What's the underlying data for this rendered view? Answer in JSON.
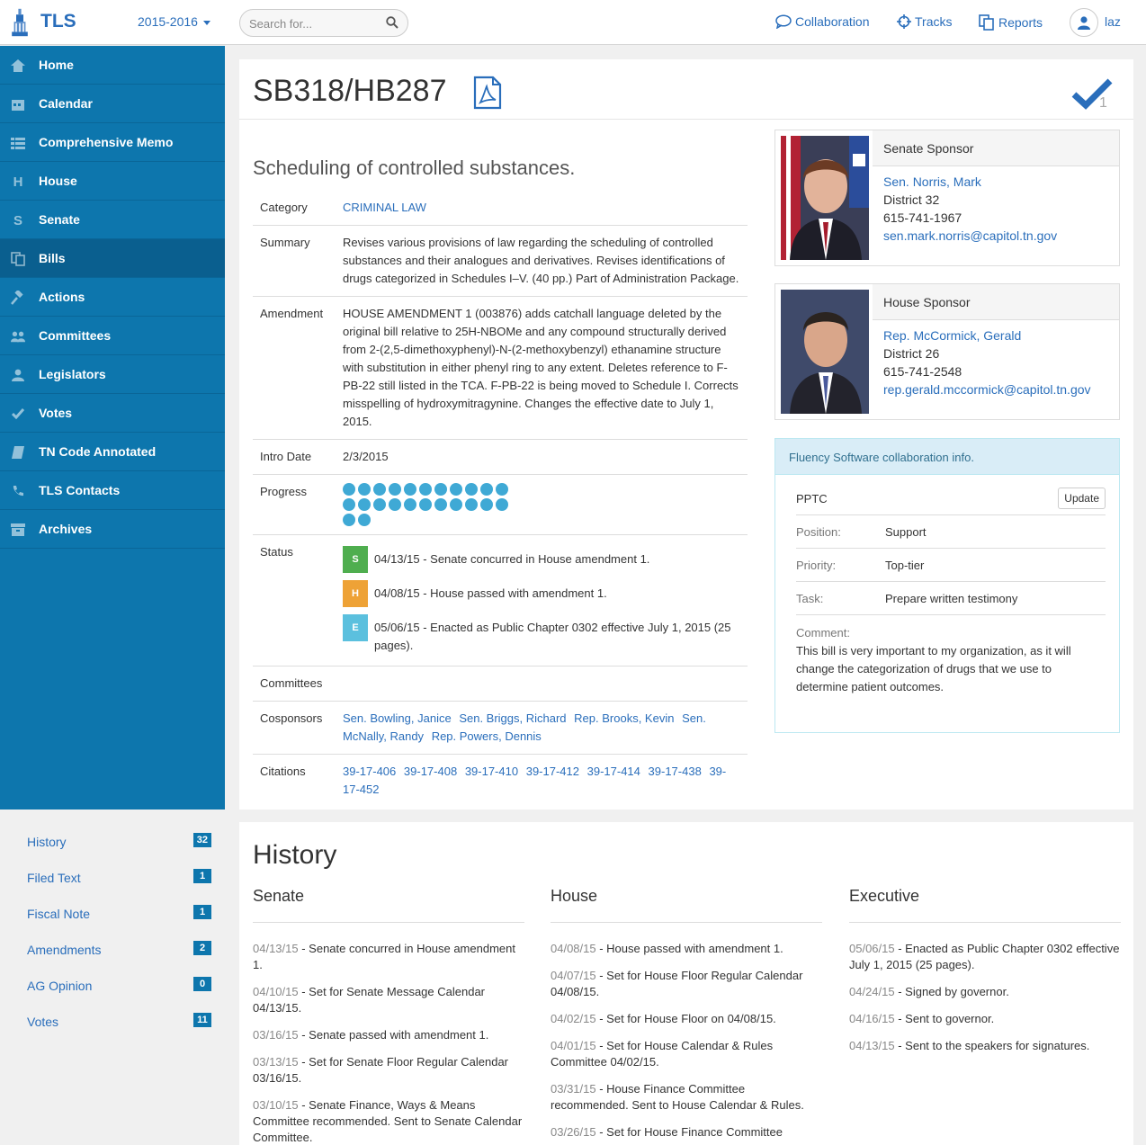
{
  "nav": {
    "logo_text": "TLS",
    "session": "2015-2016",
    "search_placeholder": "Search for...",
    "links": {
      "collaboration": "Collaboration",
      "tracks": "Tracks",
      "reports": "Reports"
    },
    "user": "laz"
  },
  "sidebar": {
    "items": [
      {
        "label": "Home",
        "icon": "home-icon"
      },
      {
        "label": "Calendar",
        "icon": "calendar-icon"
      },
      {
        "label": "Comprehensive Memo",
        "icon": "list-icon"
      },
      {
        "label": "House",
        "icon": "letter-h-icon"
      },
      {
        "label": "Senate",
        "icon": "letter-s-icon"
      },
      {
        "label": "Bills",
        "icon": "copy-icon"
      },
      {
        "label": "Actions",
        "icon": "gavel-icon"
      },
      {
        "label": "Committees",
        "icon": "users-icon"
      },
      {
        "label": "Legislators",
        "icon": "user-icon"
      },
      {
        "label": "Votes",
        "icon": "check-icon"
      },
      {
        "label": "TN Code Annotated",
        "icon": "book-icon"
      },
      {
        "label": "TLS Contacts",
        "icon": "phone-icon"
      },
      {
        "label": "Archives",
        "icon": "archive-icon"
      }
    ]
  },
  "subnav": [
    {
      "label": "History",
      "count": "32"
    },
    {
      "label": "Filed Text",
      "count": "1"
    },
    {
      "label": "Fiscal Note",
      "count": "1"
    },
    {
      "label": "Amendments",
      "count": "2"
    },
    {
      "label": "AG Opinion",
      "count": "0"
    },
    {
      "label": "Votes",
      "count": "11"
    }
  ],
  "bill": {
    "title": "SB318/HB287",
    "check_count": "1",
    "subtitle": "Scheduling of controlled substances.",
    "labels": {
      "category": "Category",
      "summary": "Summary",
      "amendment": "Amendment",
      "intro_date": "Intro Date",
      "progress": "Progress",
      "status": "Status",
      "committees": "Committees",
      "cosponsors": "Cosponsors",
      "citations": "Citations"
    },
    "category": "CRIMINAL LAW",
    "summary": "Revises various provisions of law regarding the scheduling of controlled substances and their analogues and derivatives. Revises identifications of drugs categorized in Schedules I–V. (40 pp.) Part of Administration Package.",
    "amendment": "HOUSE AMENDMENT 1 (003876) adds catchall language deleted by the original bill relative to 25H-NBOMe and any compound structurally derived from 2-(2,5-dimethoxyphenyl)-N-(2-methoxybenzyl) ethanamine structure with substitution in either phenyl ring to any extent. Deletes reference to F-PB-22 still listed in the TCA. F-PB-22 is being moved to Schedule I. Corrects misspelling of hydroxymitragynine. Changes the effective date to July 1, 2015.",
    "intro_date": "2/3/2015",
    "progress_steps": 24,
    "status": [
      {
        "badge": "S",
        "text": "04/13/15 - Senate concurred in House amendment 1."
      },
      {
        "badge": "H",
        "text": "04/08/15 - House passed with amendment 1."
      },
      {
        "badge": "E",
        "text": "05/06/15 - Enacted as Public Chapter 0302 effective July 1, 2015 (25 pages)."
      }
    ],
    "cosponsors": [
      "Sen. Bowling, Janice",
      "Sen. Briggs, Richard",
      "Rep. Brooks, Kevin",
      "Sen. McNally, Randy",
      "Rep. Powers, Dennis"
    ],
    "citations": [
      "39-17-406",
      "39-17-408",
      "39-17-410",
      "39-17-412",
      "39-17-414",
      "39-17-438",
      "39-17-452"
    ]
  },
  "senate_sponsor": {
    "heading": "Senate Sponsor",
    "name": "Sen. Norris, Mark",
    "district": "District 32",
    "phone": "615-741-1967",
    "email": "sen.mark.norris@capitol.tn.gov"
  },
  "house_sponsor": {
    "heading": "House Sponsor",
    "name": "Rep. McCormick, Gerald",
    "district": "District 26",
    "phone": "615-741-2548",
    "email": "rep.gerald.mccormick@capitol.tn.gov"
  },
  "collab": {
    "heading": "Fluency Software collaboration info.",
    "org": "PPTC",
    "update_label": "Update",
    "position_label": "Position:",
    "position": "Support",
    "priority_label": "Priority:",
    "priority": "Top-tier",
    "task_label": "Task:",
    "task": "Prepare written testimony",
    "comment_label": "Comment:",
    "comment": "This bill is very important to my organization, as it will change the categorization of drugs that we use to determine patient outcomes."
  },
  "history": {
    "title": "History",
    "columns": [
      {
        "heading": "Senate",
        "entries": [
          {
            "date": "04/13/15",
            "text": "Senate concurred in House amendment 1."
          },
          {
            "date": "04/10/15",
            "text": "Set for Senate Message Calendar 04/13/15."
          },
          {
            "date": "03/16/15",
            "text": "Senate passed with amendment 1."
          },
          {
            "date": "03/13/15",
            "text": "Set for Senate Floor Regular Calendar 03/16/15."
          },
          {
            "date": "03/10/15",
            "text": "Senate Finance, Ways & Means Committee recommended. Sent to Senate Calendar Committee."
          }
        ]
      },
      {
        "heading": "House",
        "entries": [
          {
            "date": "04/08/15",
            "text": "House passed with amendment 1."
          },
          {
            "date": "04/07/15",
            "text": "Set for House Floor Regular Calendar 04/08/15."
          },
          {
            "date": "04/02/15",
            "text": "Set for House Floor on 04/08/15."
          },
          {
            "date": "04/01/15",
            "text": "Set for House Calendar & Rules Committee 04/02/15."
          },
          {
            "date": "03/31/15",
            "text": "House Finance Committee recommended. Sent to House Calendar & Rules."
          },
          {
            "date": "03/26/15",
            "text": "Set for House Finance Committee"
          }
        ]
      },
      {
        "heading": "Executive",
        "entries": [
          {
            "date": "05/06/15",
            "text": "Enacted as Public Chapter 0302 effective July 1, 2015 (25 pages)."
          },
          {
            "date": "04/24/15",
            "text": "Signed by governor."
          },
          {
            "date": "04/16/15",
            "text": "Sent to governor."
          },
          {
            "date": "04/13/15",
            "text": "Sent to the speakers for signatures."
          }
        ]
      }
    ]
  },
  "colors": {
    "sidebar": "#0d76ad",
    "link": "#2a6ebb",
    "senate": "#4fae4f",
    "house": "#eea236",
    "executive": "#5bc0de"
  }
}
